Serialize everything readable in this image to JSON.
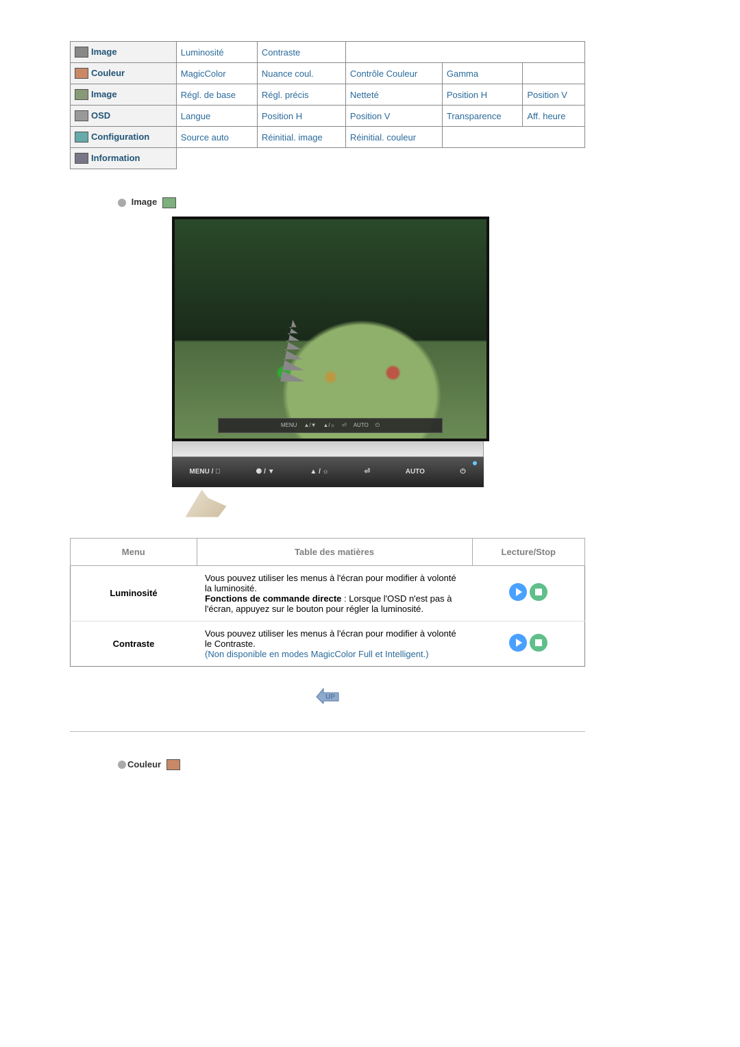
{
  "nav": {
    "rows": [
      {
        "header": "Image",
        "cells": [
          "Luminosité",
          "Contraste"
        ]
      },
      {
        "header": "Couleur",
        "cells": [
          "MagicColor",
          "Nuance coul.",
          "Contrôle Couleur",
          "Gamma"
        ]
      },
      {
        "header": "Image",
        "cells": [
          "Régl. de base",
          "Régl. précis",
          "Netteté",
          "Position H",
          "Position V"
        ]
      },
      {
        "header": "OSD",
        "cells": [
          "Langue",
          "Position H",
          "Position V",
          "Transparence",
          "Aff. heure"
        ]
      },
      {
        "header": "Configuration",
        "cells": [
          "Source auto",
          "Réinitial. image",
          "Réinitial. couleur"
        ]
      },
      {
        "header": "Information",
        "cells": []
      }
    ]
  },
  "section_image_title": "Image",
  "osd_bar_labels": [
    "MENU",
    "▲/▼",
    "▲/☼",
    "⏎",
    "AUTO",
    "⏻"
  ],
  "button_bar": [
    "MENU / ⃞",
    "⚈ / ▼",
    "▲ / ☼",
    "⏎",
    "AUTO",
    "⏻"
  ],
  "info_table": {
    "headers": {
      "menu": "Menu",
      "toc": "Table des matières",
      "ls": "Lecture/Stop"
    },
    "rows": [
      {
        "menu": "Luminosité",
        "toc_pre": "Vous pouvez utiliser les menus à l'écran pour modifier à volonté la luminosité.",
        "toc_bold": "Fonctions de commande directe",
        "toc_post": " : Lorsque l'OSD n'est pas à l'écran, appuyez sur le bouton pour régler la luminosité."
      },
      {
        "menu": "Contraste",
        "toc_pre": "Vous pouvez utiliser les menus à l'écran pour modifier à volonté le Contraste.",
        "toc_note": "(Non disponible en modes MagicColor Full et Intelligent.)"
      }
    ]
  },
  "section_couleur_title": "Couleur",
  "up_label": "UP"
}
